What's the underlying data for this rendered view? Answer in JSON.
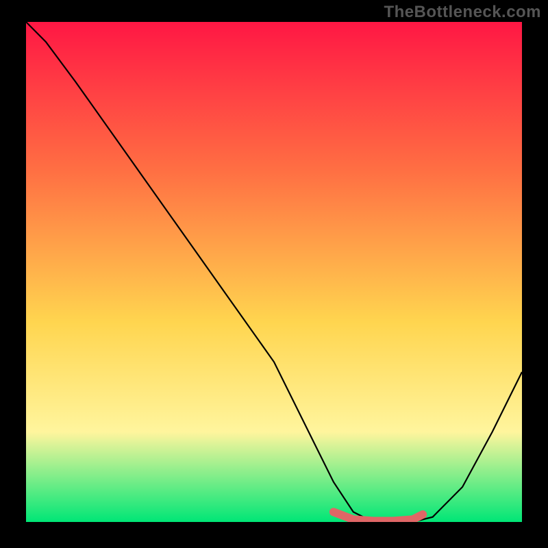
{
  "watermark": "TheBottleneck.com",
  "chart_data": {
    "type": "line",
    "title": "",
    "xlabel": "",
    "ylabel": "",
    "xlim": [
      0,
      100
    ],
    "ylim": [
      0,
      100
    ],
    "curve": {
      "x": [
        0,
        4,
        10,
        20,
        30,
        40,
        50,
        58,
        62,
        66,
        70,
        74,
        78,
        82,
        88,
        94,
        100
      ],
      "y": [
        100,
        96,
        88,
        74,
        60,
        46,
        32,
        16,
        8,
        2,
        0,
        0,
        0,
        1,
        7,
        18,
        30
      ]
    },
    "highlight_segment": {
      "x": [
        62,
        66,
        70,
        74,
        78,
        80
      ],
      "y": [
        2,
        0.5,
        0.2,
        0.2,
        0.5,
        1.5
      ]
    },
    "background_gradient": {
      "top": "#ff1744",
      "mid1": "#ff7043",
      "mid2": "#ffd54f",
      "mid3": "#fff59d",
      "bottom": "#00e676"
    }
  }
}
